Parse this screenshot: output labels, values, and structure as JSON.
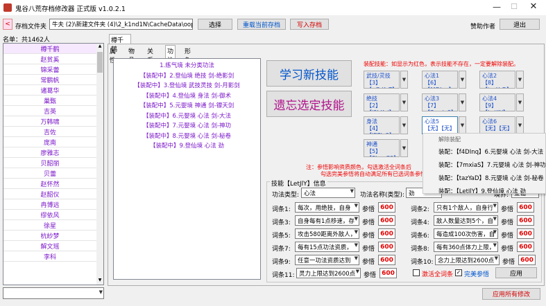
{
  "window": {
    "title": "鬼谷八荒存档修改器 正式版 v1.0.2.1"
  },
  "toolbar": {
    "archive_label": "存档文件夹",
    "path": "牛夫 (2)\\新建文件夹 (4)\\2_k1nd1N\\CacheData\\oops",
    "select": "选择",
    "reload": "重载当前存档",
    "write": "写入存档",
    "sponsor": "赞助作者",
    "exit": "退出"
  },
  "sidebar": {
    "header": "名单：共1462人",
    "names": [
      "樽千鹤",
      "赵贫奚",
      "锦采蕾",
      "常鹏帆",
      "诸葛华",
      "巢甄",
      "吉英",
      "万韩啸",
      "吉佐",
      "庞南",
      "廖雅志",
      "贝韶丽",
      "贝蕾",
      "赵怀然",
      "赵韶仪",
      "冉博远",
      "缪依风",
      "徐星",
      "杭紗梦",
      "解文瑶",
      "李科"
    ]
  },
  "character": {
    "name_tab": "樽千鹤"
  },
  "tabs": [
    "属性",
    "物品",
    "关系",
    "功法",
    "形象"
  ],
  "skills": [
    "1.练气境  未分类功法",
    "【装配中】2.登仙境  绝技  剑-绝影剑",
    "【装配中】3.登仙境  武技灵技  剑-月影剑",
    "【装配中】4.登仙境  身法  剑-御术",
    "【装配中】5.元婴境  神通  剑-镖天剑",
    "【装配中】6.元婴境  心法  剑-大法",
    "【装配中】7.元婴境  心法  剑-神功",
    "【装配中】8.元婴境  心法  剑-秘卷",
    "【装配中】9.登仙境  心法  劲"
  ],
  "big_buttons": {
    "learn": "学习新技能",
    "forget": "遗忘选定技能"
  },
  "equip": {
    "note": "装配技能：如显示为红色，表示技能不存在，一定要解除装配。",
    "slots": [
      {
        "label": "武技/灵技",
        "value": "【3】【uGrKoT】"
      },
      {
        "label": "心法1",
        "value": "【6】【f4DInq】"
      },
      {
        "label": "心法2",
        "value": "【8】【tazYaD】"
      },
      {
        "label": "绝技",
        "value": "【2】【j3hKvi】"
      },
      {
        "label": "心法3",
        "value": "【7】【7mxiaS】"
      },
      {
        "label": "心法4",
        "value": "【9】【LetJlY】"
      },
      {
        "label": "身法",
        "value": "【4】【JE7Je3】"
      },
      {
        "label": "心法5",
        "value": "【无】【无】"
      },
      {
        "label": "心法6",
        "value": "【无】【无】"
      },
      {
        "label": "神通",
        "value": "【5】【ShaeG9】"
      }
    ],
    "warning_line1": "注：参悟影响资质颜色，勾选激活全词条后",
    "warning_line2": "勾选完美参悟将自动满足所有已选词条参悟600。"
  },
  "context_menu": {
    "title": "解除装配",
    "items": [
      "装配：【f4DInq】6.元婴境 心法 剑-大法",
      "装配：【7mxiaS】7.元婴境 心法 剑-神功",
      "装配：【tazYaD】8.元婴境 心法 剑-秘卷",
      "装配：【LetJlY】9.登仙境 心法 劲"
    ]
  },
  "info": {
    "group_title": "技能【LetJlY】信息",
    "type_label": "功法类型:",
    "type_value": "心法",
    "name_label": "功法名称(类型):",
    "name_value": "劲",
    "realm_label": "境界:",
    "realm_value": "登仙",
    "entries": [
      {
        "label": "词条1:",
        "value": "每次，用绝技，自身",
        "rec_label": "参悟",
        "rec": "600"
      },
      {
        "label": "词条2:",
        "value": "只有1个敌人，自身行",
        "rec_label": "参悟",
        "rec": "600"
      },
      {
        "label": "词条3:",
        "value": "自身每有1点移速，存",
        "rec_label": "参悟",
        "rec": "600"
      },
      {
        "label": "词条4:",
        "value": "敌人数量达到5个，自",
        "rec_label": "参悟",
        "rec": "600"
      },
      {
        "label": "词条5:",
        "value": "攻击580距离外敌人，",
        "rec_label": "参悟",
        "rec": "600"
      },
      {
        "label": "词条6:",
        "value": "每造成100次伤害，自",
        "rec_label": "参悟",
        "rec": "600"
      },
      {
        "label": "词条7:",
        "value": "每有15点功法资质，",
        "rec_label": "参悟",
        "rec": "600"
      },
      {
        "label": "词条8:",
        "value": "每有360点体力上限，",
        "rec_label": "参悟",
        "rec": "600"
      },
      {
        "label": "词条9:",
        "value": "任意一功法资质达到",
        "rec_label": "参悟",
        "rec": "600"
      },
      {
        "label": "词条10:",
        "value": "念力上限达到2600点",
        "rec_label": "参悟",
        "rec": "600"
      },
      {
        "label": "词条11:",
        "value": "灵力上限达到2600点",
        "rec_label": "参悟",
        "rec": "600"
      }
    ],
    "activate_all": "激活全词条",
    "perfect": "完美参悟",
    "apply": "应用"
  },
  "footer": {
    "apply_all": "应用所有修改"
  },
  "colors": {
    "accent_purple": "#7a16c9",
    "red": "#d40000",
    "blue": "#0055cc"
  }
}
